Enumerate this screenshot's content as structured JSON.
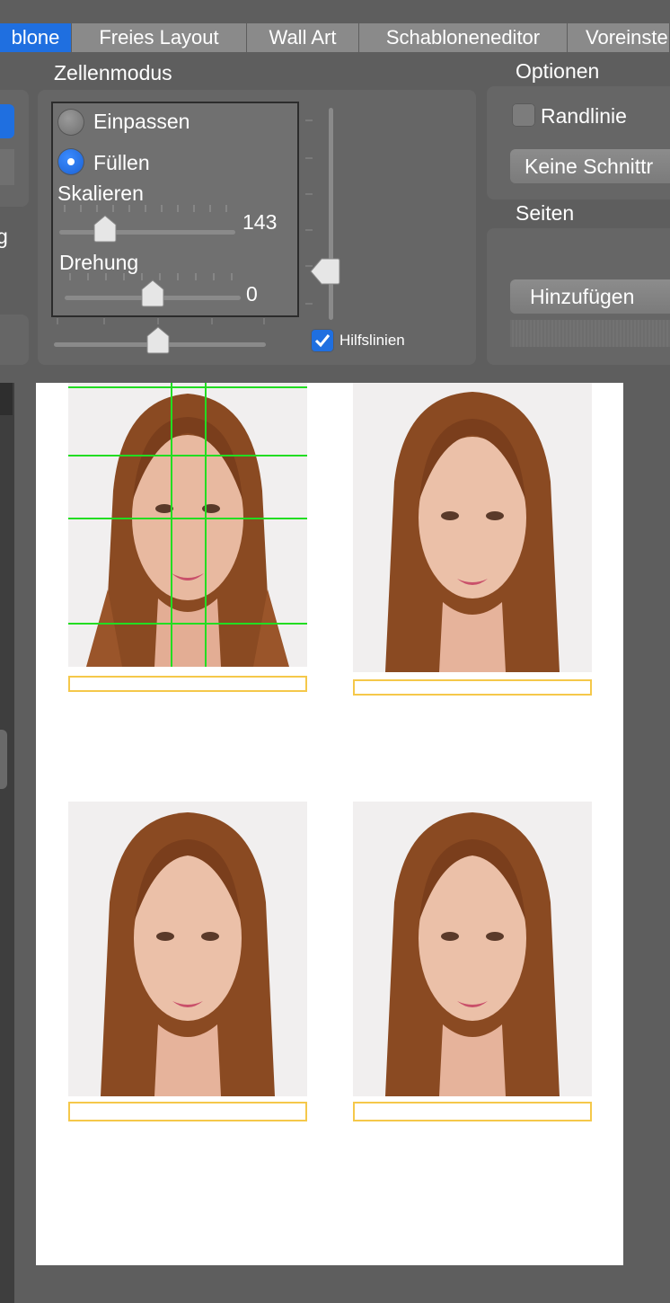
{
  "tabs": [
    {
      "label": "blone",
      "active": true
    },
    {
      "label": "Freies Layout",
      "active": false
    },
    {
      "label": "Wall Art",
      "active": false
    },
    {
      "label": "Schabloneneditor",
      "active": false
    },
    {
      "label": "Voreinste",
      "active": false
    }
  ],
  "cell_mode": {
    "title": "Zellenmodus",
    "options": [
      {
        "label": "Einpassen",
        "selected": false
      },
      {
        "label": "Füllen",
        "selected": true
      }
    ],
    "scale": {
      "label": "Skalieren",
      "value": "143"
    },
    "rotation": {
      "label": "Drehung",
      "value": "0"
    },
    "guides": {
      "label": "Hilfslinien",
      "checked": true
    }
  },
  "options": {
    "title": "Optionen",
    "border": {
      "label": "Randlinie",
      "checked": false
    },
    "no_cut_button": "Keine Schnittr"
  },
  "pages": {
    "title": "Seiten",
    "add_button": "Hinzufügen"
  },
  "left_panel_fragment": "g",
  "colors": {
    "accent": "#1f6fe0",
    "guide": "#22dd22",
    "caption_border": "#f5c84a",
    "panel": "#666666"
  },
  "photos_count_label": ""
}
